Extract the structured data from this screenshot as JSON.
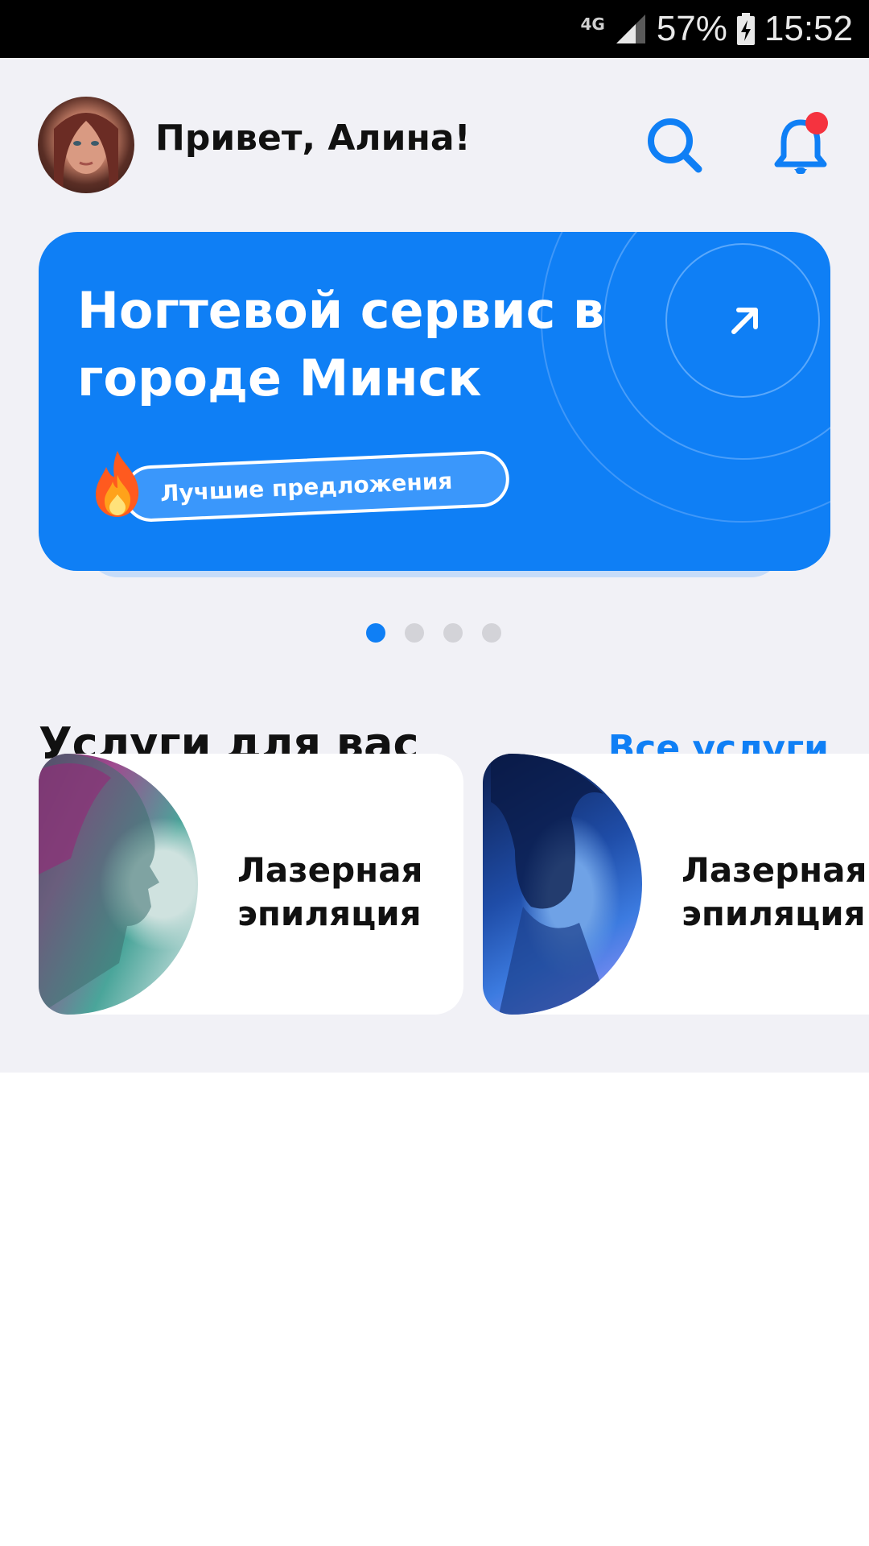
{
  "status_bar": {
    "network": "4G",
    "battery_percent": "57%",
    "time": "15:52"
  },
  "header": {
    "greeting": "Привет, Алина!",
    "notification_dot_color": "#f5333f"
  },
  "banner": {
    "title": "Ногтевой сервис в городе Минск",
    "promo_label": "Лучшие предложения",
    "background_color": "#0f7ff5"
  },
  "carousel": {
    "pages": 4,
    "active_index": 0
  },
  "services_section": {
    "title": "Услуги для вас",
    "all_link": "Все услуги",
    "items": [
      {
        "name": "Лазерная эпиляция"
      },
      {
        "name": "Лазерная эпиляция"
      }
    ]
  },
  "colors": {
    "accent": "#0f7ff5",
    "page_background": "#f1f1f6"
  }
}
